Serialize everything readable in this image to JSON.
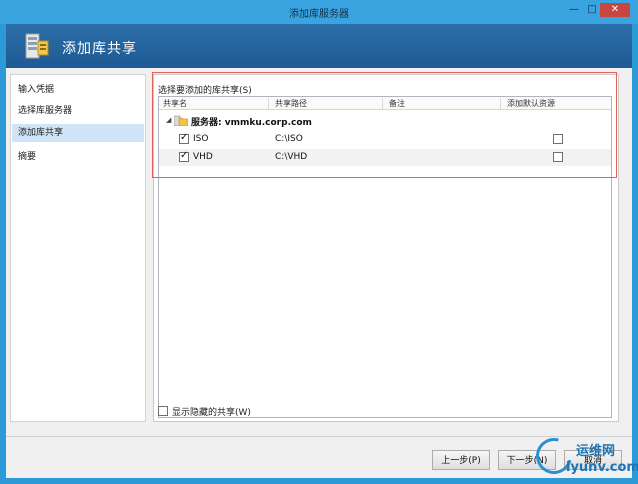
{
  "window": {
    "title": "添加库服务器",
    "min_glyph": "—",
    "max_glyph": "□",
    "close_glyph": "✕"
  },
  "header": {
    "title": "添加库共享",
    "icon": "server-wizard-icon"
  },
  "nav": {
    "items": [
      {
        "label": "输入凭据",
        "active": false
      },
      {
        "label": "选择库服务器",
        "active": false
      },
      {
        "label": "添加库共享",
        "active": true
      },
      {
        "label": "摘要",
        "active": false
      }
    ]
  },
  "content": {
    "section_label": "选择要添加的库共享(S)",
    "columns": [
      "共享名",
      "共享路径",
      "备注",
      "添加默认资源"
    ],
    "server_row": {
      "expander": "◢",
      "label": "服务器: vmmku.corp.com",
      "icon": "folder-server-icon"
    },
    "shares": [
      {
        "name": "ISO",
        "path": "C:\\ISO",
        "note": "",
        "checked": true,
        "add_default": false
      },
      {
        "name": "VHD",
        "path": "C:\\VHD",
        "note": "",
        "checked": true,
        "add_default": false
      }
    ],
    "show_hidden_label": "显示隐藏的共享(W)",
    "show_hidden_checked": false
  },
  "footer": {
    "prev_label": "上一步(P)",
    "next_label": "下一步(N)",
    "cancel_label": "取消"
  },
  "watermark": {
    "line1": "运维网",
    "line2": "iyunv.com"
  },
  "colors": {
    "titlebar": "#3aa4e0",
    "header": "#22609b",
    "selection": "#cfe4f7",
    "highlight_border": "#e0605a"
  }
}
